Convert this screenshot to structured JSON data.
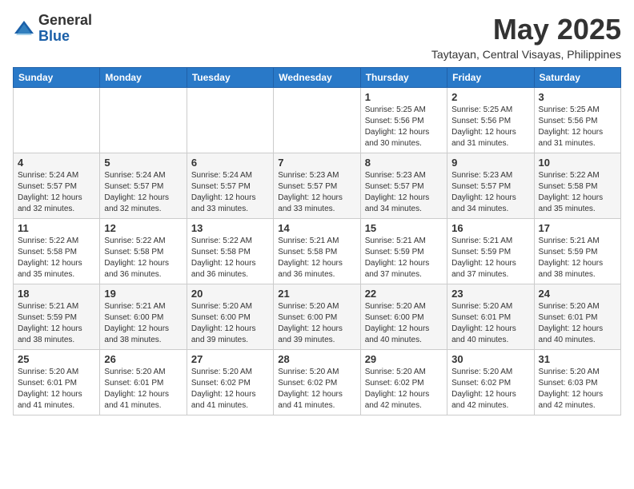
{
  "header": {
    "logo_general": "General",
    "logo_blue": "Blue",
    "month_title": "May 2025",
    "location": "Taytayan, Central Visayas, Philippines"
  },
  "days_of_week": [
    "Sunday",
    "Monday",
    "Tuesday",
    "Wednesday",
    "Thursday",
    "Friday",
    "Saturday"
  ],
  "weeks": [
    [
      {
        "day": "",
        "info": ""
      },
      {
        "day": "",
        "info": ""
      },
      {
        "day": "",
        "info": ""
      },
      {
        "day": "",
        "info": ""
      },
      {
        "day": "1",
        "info": "Sunrise: 5:25 AM\nSunset: 5:56 PM\nDaylight: 12 hours and 30 minutes."
      },
      {
        "day": "2",
        "info": "Sunrise: 5:25 AM\nSunset: 5:56 PM\nDaylight: 12 hours and 31 minutes."
      },
      {
        "day": "3",
        "info": "Sunrise: 5:25 AM\nSunset: 5:56 PM\nDaylight: 12 hours and 31 minutes."
      }
    ],
    [
      {
        "day": "4",
        "info": "Sunrise: 5:24 AM\nSunset: 5:57 PM\nDaylight: 12 hours and 32 minutes."
      },
      {
        "day": "5",
        "info": "Sunrise: 5:24 AM\nSunset: 5:57 PM\nDaylight: 12 hours and 32 minutes."
      },
      {
        "day": "6",
        "info": "Sunrise: 5:24 AM\nSunset: 5:57 PM\nDaylight: 12 hours and 33 minutes."
      },
      {
        "day": "7",
        "info": "Sunrise: 5:23 AM\nSunset: 5:57 PM\nDaylight: 12 hours and 33 minutes."
      },
      {
        "day": "8",
        "info": "Sunrise: 5:23 AM\nSunset: 5:57 PM\nDaylight: 12 hours and 34 minutes."
      },
      {
        "day": "9",
        "info": "Sunrise: 5:23 AM\nSunset: 5:57 PM\nDaylight: 12 hours and 34 minutes."
      },
      {
        "day": "10",
        "info": "Sunrise: 5:22 AM\nSunset: 5:58 PM\nDaylight: 12 hours and 35 minutes."
      }
    ],
    [
      {
        "day": "11",
        "info": "Sunrise: 5:22 AM\nSunset: 5:58 PM\nDaylight: 12 hours and 35 minutes."
      },
      {
        "day": "12",
        "info": "Sunrise: 5:22 AM\nSunset: 5:58 PM\nDaylight: 12 hours and 36 minutes."
      },
      {
        "day": "13",
        "info": "Sunrise: 5:22 AM\nSunset: 5:58 PM\nDaylight: 12 hours and 36 minutes."
      },
      {
        "day": "14",
        "info": "Sunrise: 5:21 AM\nSunset: 5:58 PM\nDaylight: 12 hours and 36 minutes."
      },
      {
        "day": "15",
        "info": "Sunrise: 5:21 AM\nSunset: 5:59 PM\nDaylight: 12 hours and 37 minutes."
      },
      {
        "day": "16",
        "info": "Sunrise: 5:21 AM\nSunset: 5:59 PM\nDaylight: 12 hours and 37 minutes."
      },
      {
        "day": "17",
        "info": "Sunrise: 5:21 AM\nSunset: 5:59 PM\nDaylight: 12 hours and 38 minutes."
      }
    ],
    [
      {
        "day": "18",
        "info": "Sunrise: 5:21 AM\nSunset: 5:59 PM\nDaylight: 12 hours and 38 minutes."
      },
      {
        "day": "19",
        "info": "Sunrise: 5:21 AM\nSunset: 6:00 PM\nDaylight: 12 hours and 38 minutes."
      },
      {
        "day": "20",
        "info": "Sunrise: 5:20 AM\nSunset: 6:00 PM\nDaylight: 12 hours and 39 minutes."
      },
      {
        "day": "21",
        "info": "Sunrise: 5:20 AM\nSunset: 6:00 PM\nDaylight: 12 hours and 39 minutes."
      },
      {
        "day": "22",
        "info": "Sunrise: 5:20 AM\nSunset: 6:00 PM\nDaylight: 12 hours and 40 minutes."
      },
      {
        "day": "23",
        "info": "Sunrise: 5:20 AM\nSunset: 6:01 PM\nDaylight: 12 hours and 40 minutes."
      },
      {
        "day": "24",
        "info": "Sunrise: 5:20 AM\nSunset: 6:01 PM\nDaylight: 12 hours and 40 minutes."
      }
    ],
    [
      {
        "day": "25",
        "info": "Sunrise: 5:20 AM\nSunset: 6:01 PM\nDaylight: 12 hours and 41 minutes."
      },
      {
        "day": "26",
        "info": "Sunrise: 5:20 AM\nSunset: 6:01 PM\nDaylight: 12 hours and 41 minutes."
      },
      {
        "day": "27",
        "info": "Sunrise: 5:20 AM\nSunset: 6:02 PM\nDaylight: 12 hours and 41 minutes."
      },
      {
        "day": "28",
        "info": "Sunrise: 5:20 AM\nSunset: 6:02 PM\nDaylight: 12 hours and 41 minutes."
      },
      {
        "day": "29",
        "info": "Sunrise: 5:20 AM\nSunset: 6:02 PM\nDaylight: 12 hours and 42 minutes."
      },
      {
        "day": "30",
        "info": "Sunrise: 5:20 AM\nSunset: 6:02 PM\nDaylight: 12 hours and 42 minutes."
      },
      {
        "day": "31",
        "info": "Sunrise: 5:20 AM\nSunset: 6:03 PM\nDaylight: 12 hours and 42 minutes."
      }
    ]
  ]
}
